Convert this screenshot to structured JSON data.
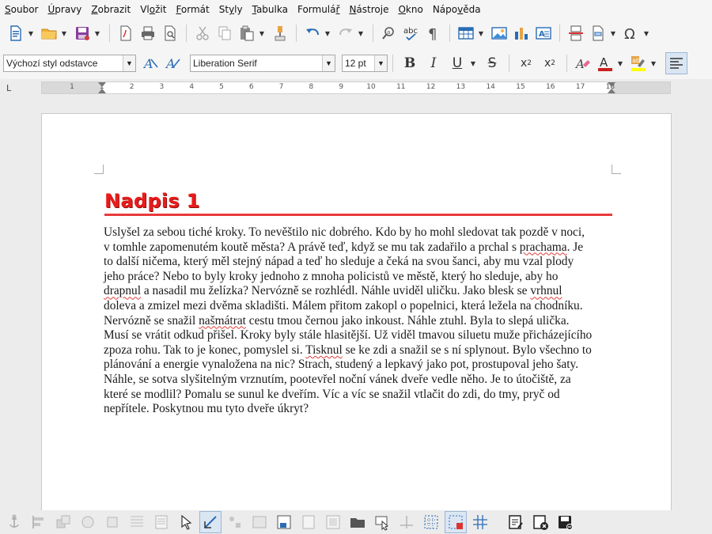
{
  "menu": [
    {
      "pre": "",
      "acc": "S",
      "post": "oubor"
    },
    {
      "pre": "",
      "acc": "Ú",
      "post": "pravy"
    },
    {
      "pre": "",
      "acc": "Z",
      "post": "obrazit"
    },
    {
      "pre": "Vl",
      "acc": "o",
      "post": "žit"
    },
    {
      "pre": "",
      "acc": "F",
      "post": "ormát"
    },
    {
      "pre": "St",
      "acc": "y",
      "post": "ly"
    },
    {
      "pre": "",
      "acc": "T",
      "post": "abulka"
    },
    {
      "pre": "Formulá",
      "acc": "ř",
      "post": ""
    },
    {
      "pre": "",
      "acc": "N",
      "post": "ástroje"
    },
    {
      "pre": "",
      "acc": "O",
      "post": "kno"
    },
    {
      "pre": "Nápo",
      "acc": "v",
      "post": "ěda"
    }
  ],
  "formatting": {
    "paragraph_style": "Výchozí styl odstavce",
    "font_name": "Liberation Serif",
    "font_size": "12 pt"
  },
  "ruler": {
    "numbers": [
      "1",
      "1",
      "2",
      "3",
      "4",
      "5",
      "6",
      "7",
      "8",
      "9",
      "10",
      "11",
      "12",
      "13",
      "14",
      "15",
      "16",
      "17",
      "18"
    ],
    "tab_marker": "L"
  },
  "document": {
    "heading": "Nadpis 1",
    "lines": [
      [
        {
          "t": "Uslyšel za sebou tiché kroky. To nevěštilo nic dobrého. Kdo by ho mohl sledovat tak pozdě v noci,"
        }
      ],
      [
        {
          "t": "v tomhle zapomenutém koutě města? A právě teď, když se mu tak zadařilo a prchal s "
        },
        {
          "t": "prachama",
          "sq": true
        },
        {
          "t": ". Je"
        }
      ],
      [
        {
          "t": "to další ničema, který měl stejný nápad a teď ho sleduje a čeká na svou šanci, aby mu vzal plody"
        }
      ],
      [
        {
          "t": "jeho práce? Nebo to byly kroky jednoho z mnoha policistů ve městě, který ho sleduje, aby ho"
        }
      ],
      [
        {
          "t": "drapnul",
          "sq": true
        },
        {
          "t": " a nasadil mu želízka? Nervózně se rozhlédl. Náhle uviděl uličku. Jako blesk se "
        },
        {
          "t": "vrhnul",
          "sq": true
        }
      ],
      [
        {
          "t": "doleva a zmizel mezi dvěma skladišti. Málem přitom zakopl o popelnici, která ležela na chodníku."
        }
      ],
      [
        {
          "t": "Nervózně se snažil "
        },
        {
          "t": "našmátrat",
          "sq": true
        },
        {
          "t": " cestu tmou černou jako inkoust. Náhle ztuhl. Byla to slepá ulička."
        }
      ],
      [
        {
          "t": "Musí se vrátit odkud přišel. Kroky byly stále hlasitější. Už viděl tmavou siluetu muže přicházejícího"
        }
      ],
      [
        {
          "t": "zpoza rohu. Tak to je konec, pomyslel si. "
        },
        {
          "t": "Tisknul",
          "sq": true
        },
        {
          "t": " se ke zdi a snažil se s ní splynout. Bylo všechno to"
        }
      ],
      [
        {
          "t": "plánování a energie vynaložena na nic? Strach, studený a lepkavý jako pot, prostupoval jeho šaty."
        }
      ],
      [
        {
          "t": "Náhle, se sotva slyšitelným vrznutím, pootevřel noční vánek dveře vedle něho. Je to útočiště, za"
        }
      ],
      [
        {
          "t": "které se modlil? Pomalu se sunul ke dveřím. Víc a víc se snažil vtlačit do zdi, do tmy, pryč od"
        }
      ],
      [
        {
          "t": "nepřítele. Poskytnou mu tyto dveře úkryt?"
        }
      ]
    ]
  },
  "colors": {
    "heading": "#ea1b1b",
    "font_color_bar": "#c9211e",
    "highlight_bar": "#ffff00",
    "spellcheck": "#e23b3b"
  },
  "icons": {
    "toolbar1": [
      "new-document-icon",
      "open-folder-icon",
      "save-icon",
      "export-pdf-icon",
      "print-icon",
      "print-preview-icon",
      "cut-icon",
      "copy-icon",
      "paste-icon",
      "clone-formatting-icon",
      "undo-icon",
      "redo-icon",
      "find-replace-icon",
      "spellcheck-icon",
      "formatting-marks-icon",
      "insert-table-icon",
      "insert-image-icon",
      "insert-chart-icon",
      "insert-textbox-icon",
      "page-break-icon",
      "insert-field-icon",
      "special-character-icon"
    ],
    "toolbar2": [
      "update-style-icon",
      "new-style-icon",
      "bold-icon",
      "italic-icon",
      "underline-icon",
      "strikethrough-icon",
      "superscript-icon",
      "subscript-icon",
      "clear-formatting-icon",
      "font-color-icon",
      "highlight-icon",
      "align-left-icon"
    ],
    "bottom": [
      "anchor-icon",
      "align-objects-icon",
      "arrange-icon",
      "wrap-off-icon",
      "wrap-icon",
      "wrap-ideal-icon",
      "select-icon",
      "draw-functions-icon",
      "points-icon",
      "group-icon",
      "fontwork-icon",
      "frame-icon",
      "image-icon",
      "insert-object-icon",
      "open-icon",
      "select-tool-icon",
      "move-icon",
      "grid-icon",
      "snap-grid-icon",
      "helplines-icon",
      "track-changes-icon",
      "close-document-icon",
      "save-document-icon"
    ]
  }
}
